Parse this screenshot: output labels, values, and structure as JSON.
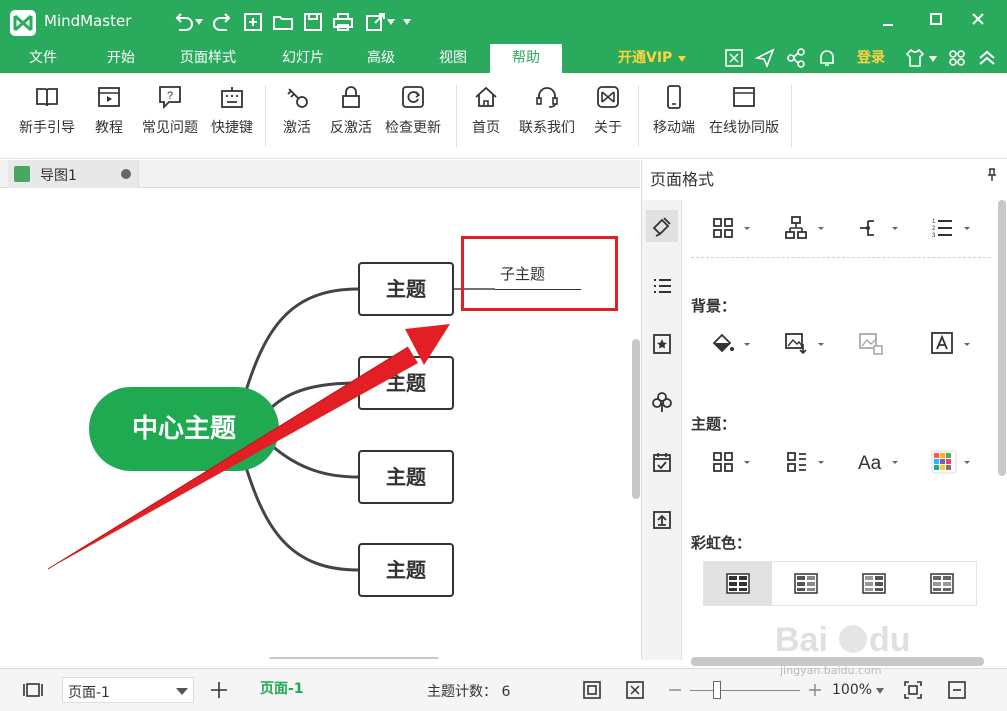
{
  "app": {
    "title": "MindMaster"
  },
  "menu": {
    "tabs": [
      "文件",
      "开始",
      "页面样式",
      "幻灯片",
      "高级",
      "视图",
      "帮助"
    ],
    "active_tab": "帮助",
    "vip": "开通VIP",
    "login": "登录"
  },
  "ribbon": {
    "buttons": [
      {
        "label": "新手引导",
        "icon": "book-icon"
      },
      {
        "label": "教程",
        "icon": "video-icon"
      },
      {
        "label": "常见问题",
        "icon": "question-icon"
      },
      {
        "label": "快捷键",
        "icon": "keyboard-icon"
      },
      {
        "label": "激活",
        "icon": "key-icon"
      },
      {
        "label": "反激活",
        "icon": "lock-icon"
      },
      {
        "label": "检查更新",
        "icon": "refresh-icon"
      },
      {
        "label": "首页",
        "icon": "home-icon"
      },
      {
        "label": "联系我们",
        "icon": "headset-icon"
      },
      {
        "label": "关于",
        "icon": "logo-icon"
      },
      {
        "label": "移动端",
        "icon": "mobile-icon"
      },
      {
        "label": "在线协同版",
        "icon": "browser-icon"
      }
    ]
  },
  "document": {
    "tab_name": "导图1"
  },
  "mindmap": {
    "central": "中心主题",
    "topics": [
      "主题",
      "主题",
      "主题",
      "主题"
    ],
    "subtopic": "子主题",
    "accent": "#1faa52",
    "highlight": "#e31e24"
  },
  "panel": {
    "title": "页面格式",
    "background_label": "背景：",
    "theme_label": "主题：",
    "rainbow_label": "彩虹色：",
    "theme_font_icon_text": "Aa"
  },
  "status": {
    "page_select": "页面-1",
    "page_tab": "页面-1",
    "topic_count": "主题计数： 6",
    "zoom": "100%"
  },
  "watermark": {
    "text": "jingyan.baidu.com"
  }
}
